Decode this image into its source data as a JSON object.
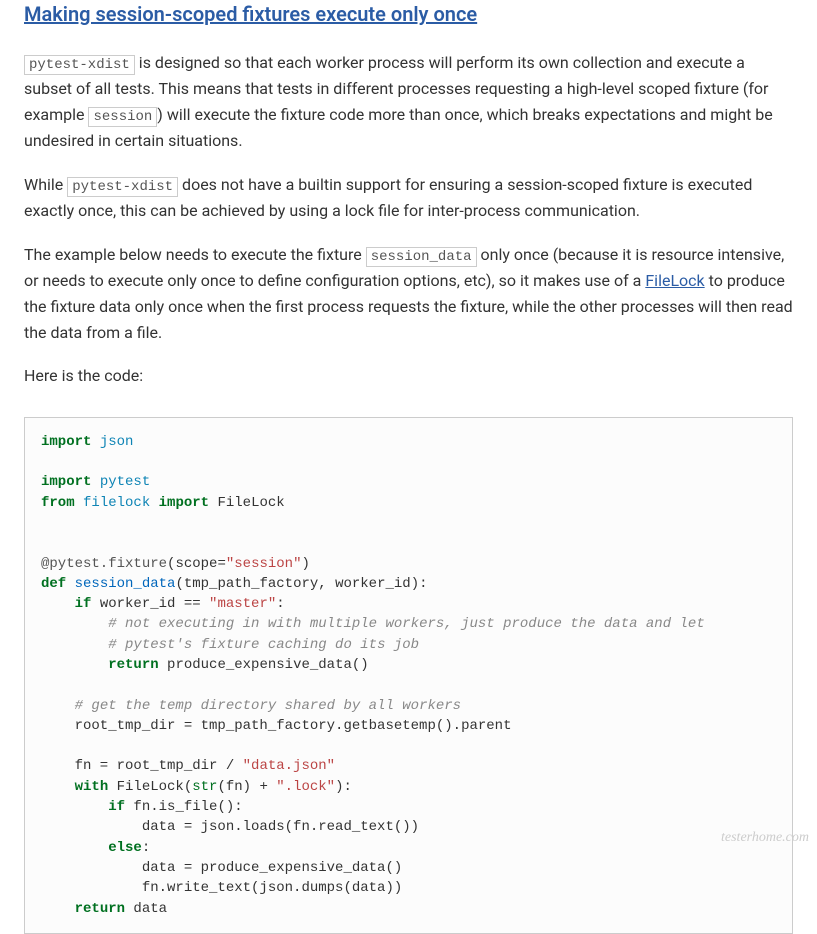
{
  "heading": "Making session-scoped fixtures execute only once",
  "para1": {
    "code1": "pytest-xdist",
    "t1": " is designed so that each worker process will perform its own collection and execute a subset of all tests. This means that tests in different processes requesting a high-level scoped fixture (for example ",
    "code2": "session",
    "t2": ") will execute the fixture code more than once, which breaks expectations and might be undesired in certain situations."
  },
  "para2": {
    "t1": "While ",
    "code1": "pytest-xdist",
    "t2": " does not have a builtin support for ensuring a session-scoped fixture is executed exactly once, this can be achieved by using a lock file for inter-process communication."
  },
  "para3": {
    "t1": "The example below needs to execute the fixture ",
    "code1": "session_data",
    "t2": " only once (because it is resource intensive, or needs to execute only once to define configuration options, etc), so it makes use of a ",
    "link": "FileLock",
    "t3": " to produce the fixture data only once when the first process requests the fixture, while the other processes will then read the data from a file."
  },
  "para4": "Here is the code:",
  "code": {
    "import1": "import",
    "json": "json",
    "import2": "import",
    "pytest": "pytest",
    "from": "from",
    "filelock_mod": "filelock",
    "import3": "import",
    "filelock_cls": "FileLock",
    "decorator": "@pytest.fixture",
    "scope_kw": "scope",
    "session_str": "\"session\"",
    "def": "def",
    "fn_name": "session_data",
    "params": "(tmp_path_factory, worker_id):",
    "if1": "if",
    "cond1": " worker_id == ",
    "master_str": "\"master\"",
    "comment1": "# not executing in with multiple workers, just produce the data and let",
    "comment2": "# pytest's fixture caching do its job",
    "return1": "return",
    "call1": " produce_expensive_data()",
    "comment3": "# get the temp directory shared by all workers",
    "line_root": "    root_tmp_dir = tmp_path_factory.getbasetemp().parent",
    "line_fn_a": "    fn = root_tmp_dir / ",
    "data_json_str": "\"data.json\"",
    "with": "with",
    "with_body_a": " FileLock(",
    "str_kw": "str",
    "with_body_b": "(fn) + ",
    "lock_str": "\".lock\"",
    "with_body_c": "):",
    "if2": "if",
    "cond2": " fn.is_file():",
    "line_loads": "            data = json.loads(fn.read_text())",
    "else": "else",
    "line_prod": "            data = produce_expensive_data()",
    "line_write": "            fn.write_text(json.dumps(data))",
    "return2": "return",
    "ret_data": " data"
  },
  "watermark": "testerhome.com"
}
